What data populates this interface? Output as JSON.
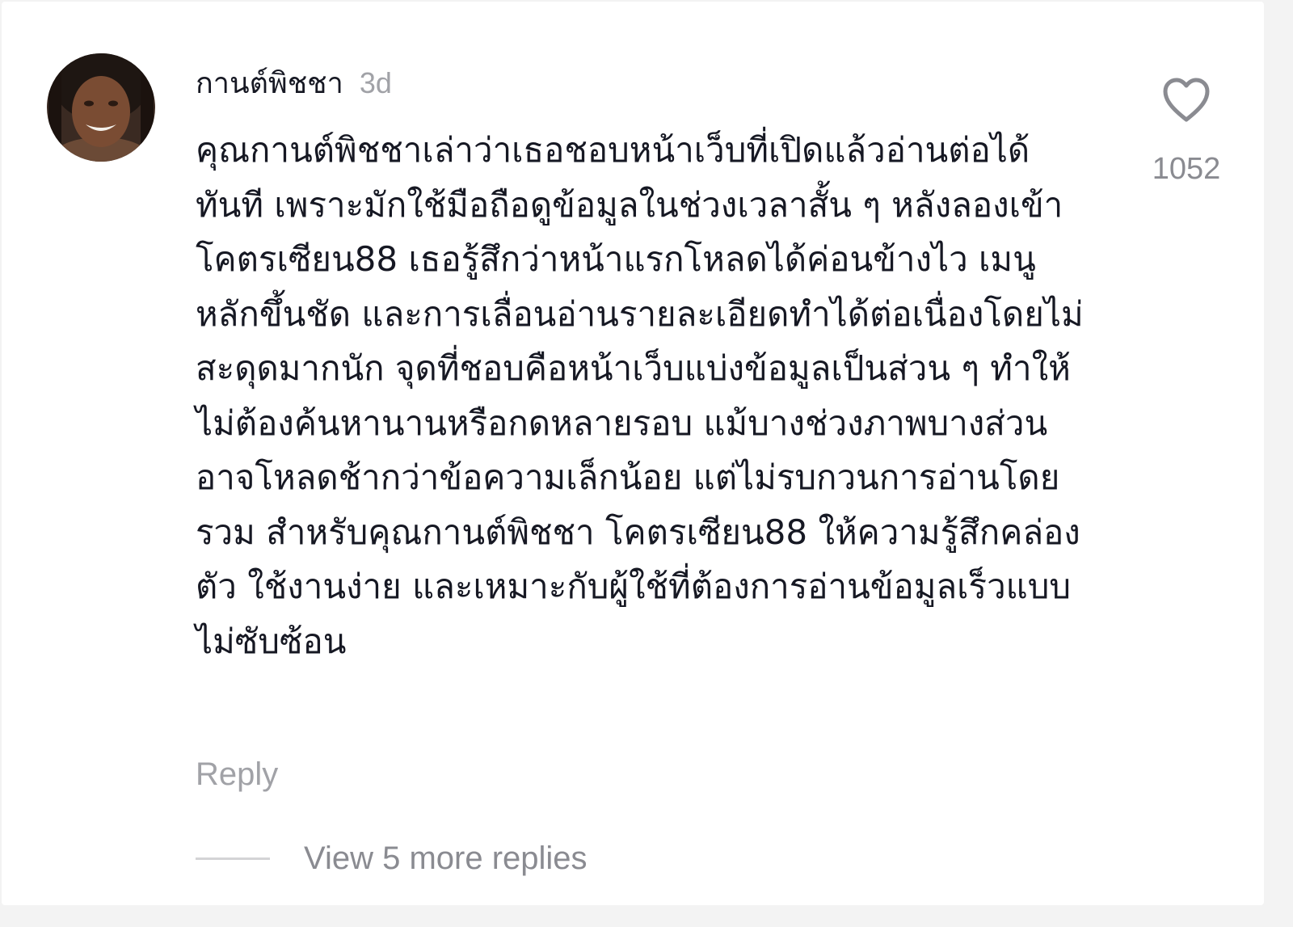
{
  "comment": {
    "username": "กานต์พิชชา",
    "timestamp": "3d",
    "text": "คุณกานต์พิชชาเล่าว่าเธอชอบหน้าเว็บที่เปิดแล้วอ่านต่อได้ทันที เพราะมักใช้มือถือดูข้อมูลในช่วงเวลาสั้น ๆ หลังลองเข้าโคตรเซียน88 เธอรู้สึกว่าหน้าแรกโหลดได้ค่อนข้างไว เมนูหลักขึ้นชัด และการเลื่อนอ่านรายละเอียดทำได้ต่อเนื่องโดยไม่สะดุดมากนัก จุดที่ชอบคือหน้าเว็บแบ่งข้อมูลเป็นส่วน ๆ ทำให้ไม่ต้องค้นหานานหรือกดหลายรอบ แม้บางช่วงภาพบางส่วนอาจโหลดช้ากว่าข้อความเล็กน้อย แต่ไม่รบกวนการอ่านโดยรวม สำหรับคุณกานต์พิชชา โคตรเซียน88 ให้ความรู้สึกคล่องตัว ใช้งานง่าย และเหมาะกับผู้ใช้ที่ต้องการอ่านข้อมูลเร็วแบบไม่ซับซ้อน",
    "like_count": "1052",
    "like_icon": "heart-outline-icon",
    "reply_label": "Reply",
    "view_replies_label": "View 5 more replies"
  },
  "colors": {
    "text_primary": "#161823",
    "text_secondary": "#a1a2a7",
    "icon": "#8a8b91",
    "background": "#ffffff"
  }
}
